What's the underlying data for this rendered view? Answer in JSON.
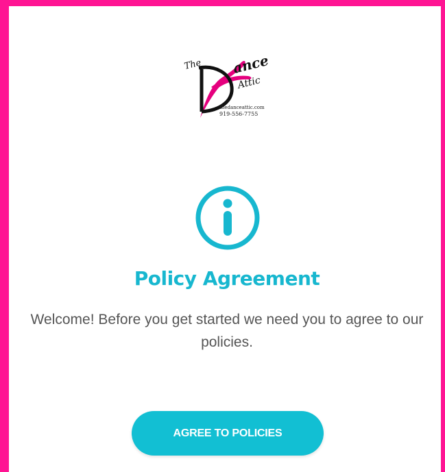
{
  "logo": {
    "word_the": "The",
    "word_dance": "ance",
    "word_attic": "Attic",
    "website": "thedanceattic.com",
    "phone": "919-556-7755"
  },
  "icon": "info-icon",
  "title": "Policy Agreement",
  "message": "Welcome! Before you get started we need you to agree to our policies.",
  "button": {
    "label": "AGREE TO POLICIES"
  },
  "colors": {
    "border": "#ff1493",
    "accent": "#17b7cf",
    "button": "#12bfd3"
  }
}
